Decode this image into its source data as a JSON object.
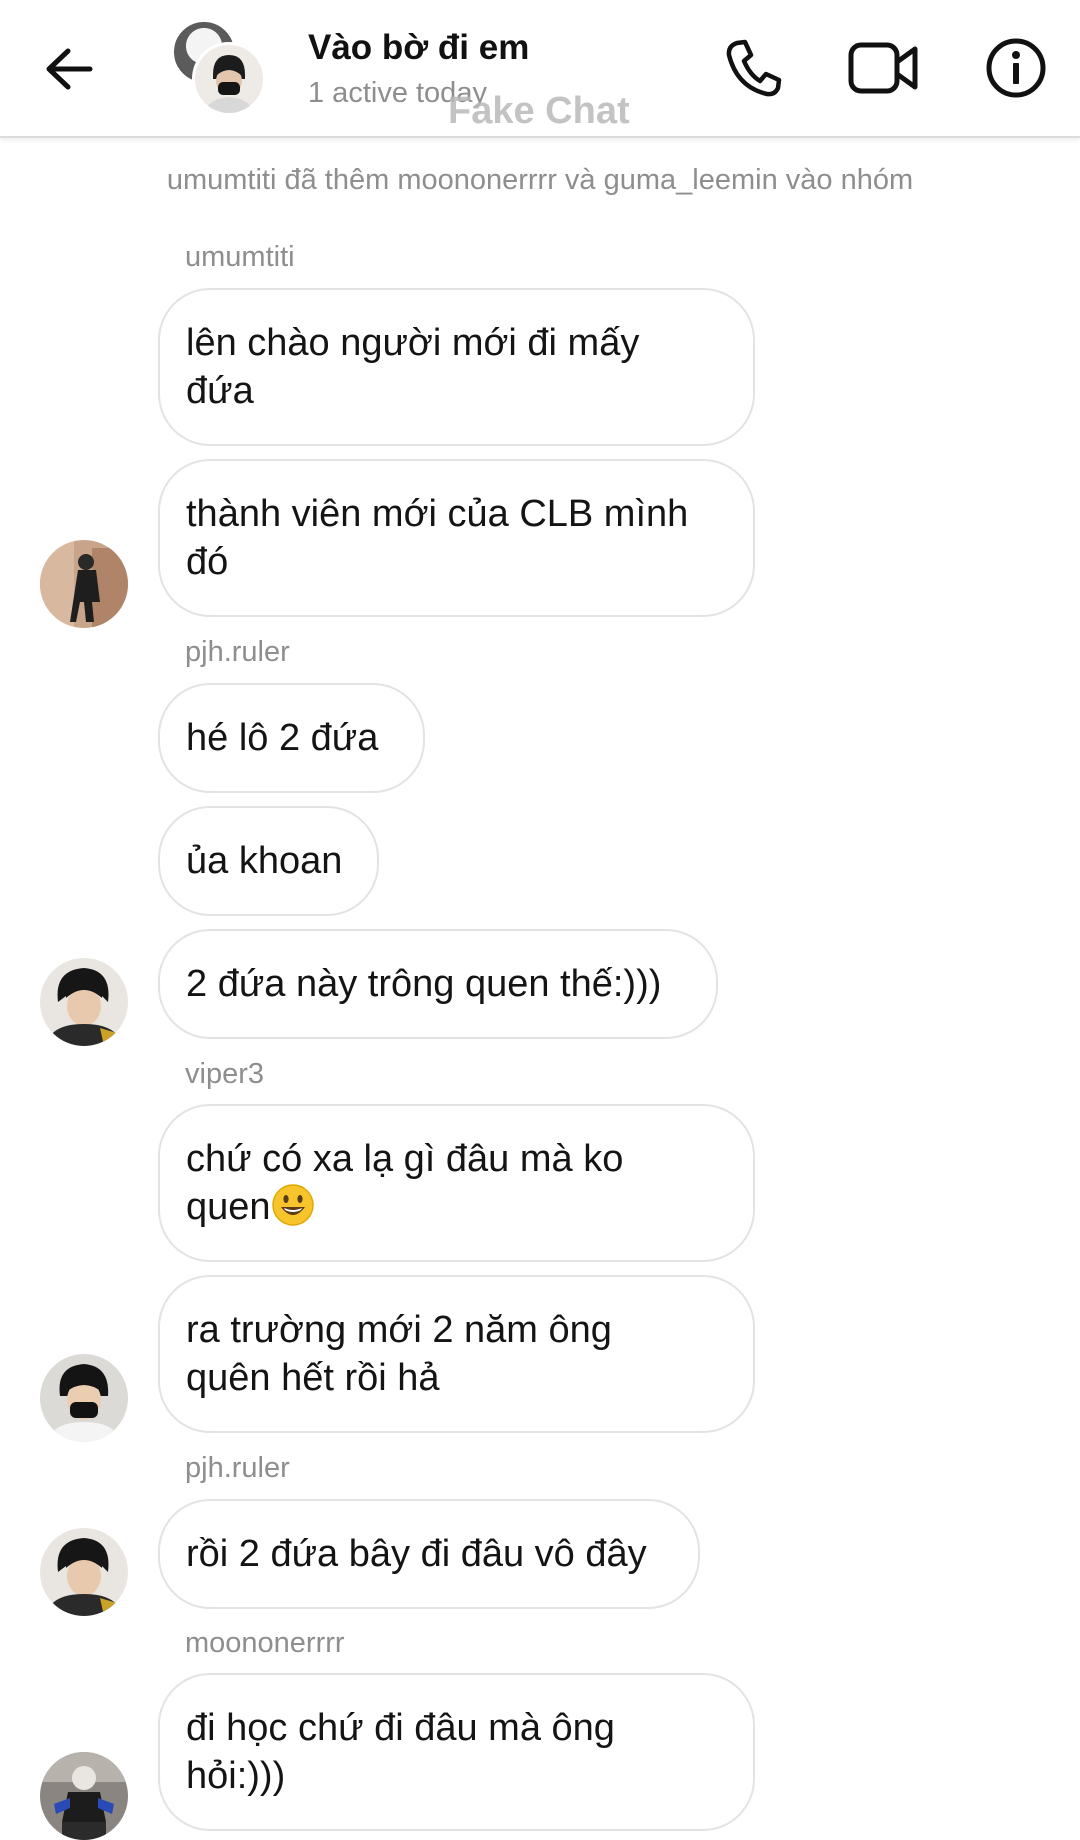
{
  "header": {
    "title": "Vào bờ đi em",
    "status": "1 active today",
    "watermark": "Fake Chat",
    "icons": [
      "back-arrow-icon",
      "phone-icon",
      "video-camera-icon",
      "info-icon"
    ]
  },
  "system_message": "umumtiti đã thêm moononerrrr và guma_leemin vào nhóm",
  "messages": [
    {
      "sender": "umumtiti",
      "bubbles": [
        {
          "lines": [
            "lên chào người mới đi mấy",
            "đứa"
          ]
        },
        {
          "lines": [
            "thành viên mới của CLB mình",
            "đó"
          ]
        }
      ]
    },
    {
      "sender": "pjh.ruler",
      "bubbles": [
        {
          "lines": [
            "hé lô 2 đứa"
          ]
        },
        {
          "lines": [
            "ủa khoan"
          ]
        },
        {
          "lines": [
            "2 đứa này trông quen thế:)))"
          ]
        }
      ]
    },
    {
      "sender": "viper3",
      "bubbles": [
        {
          "lines": [
            "chứ có xa lạ gì đâu mà ko",
            "quen"
          ],
          "emoji": "smiling-face-emoji"
        },
        {
          "lines": [
            "ra trường mới 2 năm ông",
            "quên hết rồi hả"
          ]
        }
      ]
    },
    {
      "sender": "pjh.ruler",
      "bubbles": [
        {
          "lines": [
            "rồi 2 đứa bây đi đâu vô đây"
          ]
        }
      ]
    },
    {
      "sender": "moononerrrr",
      "bubbles": [
        {
          "lines": [
            "đi học chứ đi đâu mà ông",
            "hỏi:)))"
          ]
        }
      ]
    }
  ],
  "colors": {
    "bubble_border": "#e3e3e3",
    "meta_text": "#8e8e8e",
    "text": "#141414",
    "emoji": "#f7c52b"
  }
}
